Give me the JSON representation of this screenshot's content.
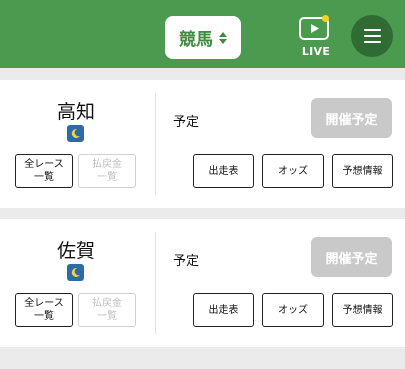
{
  "header": {
    "sport_label": "競馬",
    "live_label": "LIVE",
    "accent_color": "#4b9a4f"
  },
  "races": [
    {
      "venue": "高知",
      "night_icon": "crescent-moon-icon",
      "results_button": "全レース\n一覧",
      "payout_button": "払戻金\n一覧",
      "status": "予定",
      "open_button": "開催予定",
      "entry_button": "出走表",
      "odds_button": "オッズ",
      "prediction_button": "予想情報"
    },
    {
      "venue": "佐賀",
      "night_icon": "crescent-moon-icon",
      "results_button": "全レース\n一覧",
      "payout_button": "払戻金\n一覧",
      "status": "予定",
      "open_button": "開催予定",
      "entry_button": "出走表",
      "odds_button": "オッズ",
      "prediction_button": "予想情報"
    }
  ]
}
